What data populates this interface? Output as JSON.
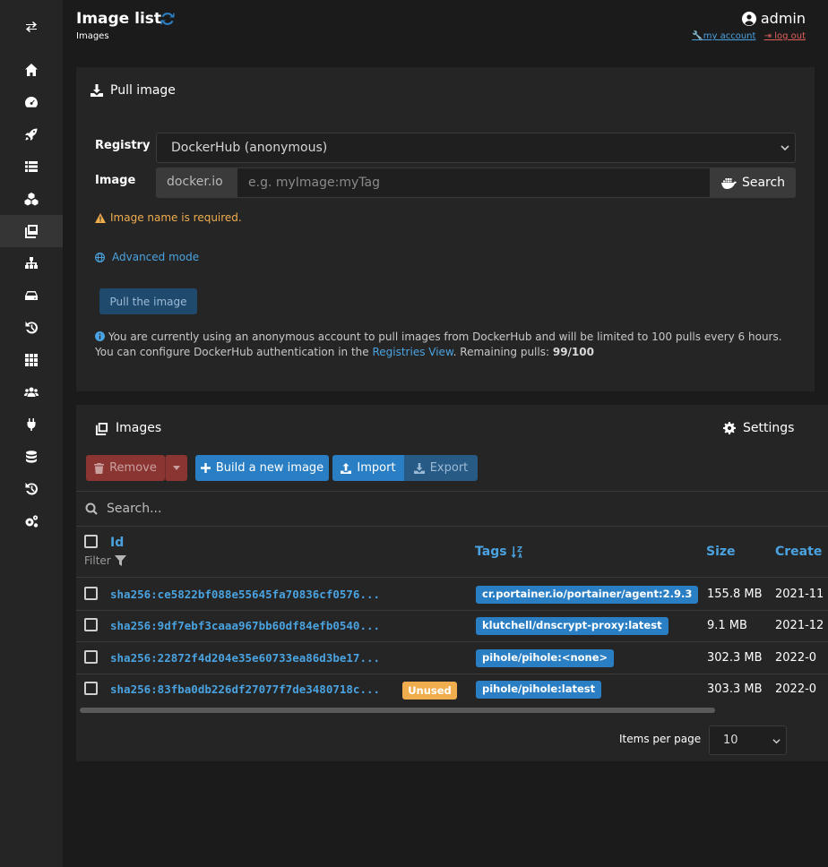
{
  "header": {
    "title": "Image list",
    "subtitle": "Images",
    "username": "admin",
    "my_account": "my account",
    "log_out": "log out"
  },
  "sidebar": {
    "items": [
      {
        "icon": "switch-icon"
      },
      {
        "icon": "home-icon"
      },
      {
        "icon": "dashboard-icon"
      },
      {
        "icon": "rocket-icon"
      },
      {
        "icon": "list-icon"
      },
      {
        "icon": "cubes-icon"
      },
      {
        "icon": "images-icon",
        "active": true
      },
      {
        "icon": "network-icon"
      },
      {
        "icon": "hdd-icon"
      },
      {
        "icon": "history-icon"
      },
      {
        "icon": "apps-icon"
      },
      {
        "icon": "users-icon"
      },
      {
        "icon": "plug-icon"
      },
      {
        "icon": "database-icon"
      },
      {
        "icon": "history-icon"
      },
      {
        "icon": "settings-icon"
      }
    ]
  },
  "pull": {
    "heading": "Pull image",
    "registry_label": "Registry",
    "registry_value": "DockerHub (anonymous)",
    "image_label": "Image",
    "image_prefix": "docker.io",
    "image_placeholder": "e.g. myImage:myTag",
    "search_label": "Search",
    "warning": "Image name is required.",
    "advanced": "Advanced mode",
    "pull_button": "Pull the image",
    "info_text": "You are currently using an anonymous account to pull images from DockerHub and will be limited to 100 pulls every 6 hours. You can configure DockerHub authentication in the",
    "info_link": "Registries View",
    "info_remaining_label": ". Remaining pulls:",
    "info_remaining_value": "99/100"
  },
  "images": {
    "heading": "Images",
    "settings": "Settings",
    "remove": "Remove",
    "build": "Build a new image",
    "import": "Import",
    "export": "Export",
    "search_placeholder": "Search...",
    "columns": {
      "id": "Id",
      "filter": "Filter",
      "tags": "Tags",
      "size": "Size",
      "created": "Create"
    },
    "rows": [
      {
        "id": "sha256:ce5822bf088e55645fa70836cf0576...",
        "tag": "cr.portainer.io/portainer/agent:2.9.3",
        "size": "155.8 MB",
        "created": "2021-11"
      },
      {
        "id": "sha256:9df7ebf3caaa967bb60df84efb0540...",
        "tag": "klutchell/dnscrypt-proxy:latest",
        "size": "9.1 MB",
        "created": "2021-12"
      },
      {
        "id": "sha256:22872f4d204e35e60733ea86d3be17...",
        "tag": "pihole/pihole:<none>",
        "size": "302.3 MB",
        "created": "2022-0"
      },
      {
        "id": "sha256:83fba0db226df27077f7de3480718c...",
        "tag": "pihole/pihole:latest",
        "size": "303.3 MB",
        "created": "2022-0",
        "unused": "Unused"
      }
    ],
    "items_per_page_label": "Items per page",
    "items_per_page_value": "10"
  },
  "colors": {
    "accent": "#4aa3e0",
    "danger": "#b84a45",
    "warning": "#f0ad4e",
    "tag": "#2a7fc4"
  }
}
